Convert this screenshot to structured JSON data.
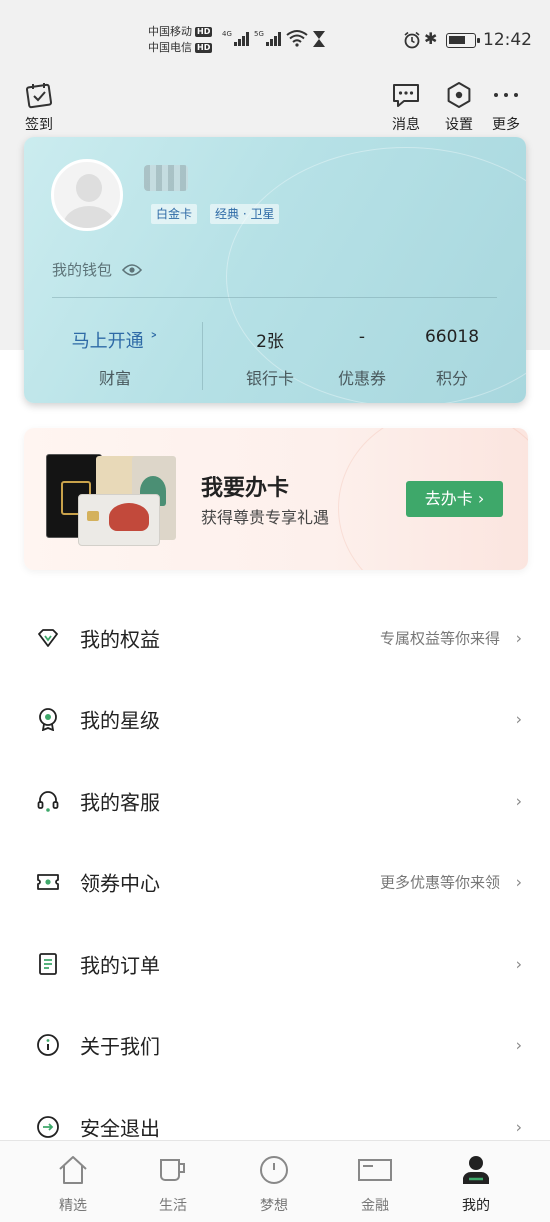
{
  "status_bar": {
    "carrier1": "中国移动",
    "carrier2": "中国电信",
    "hd": "HD",
    "net1": "4G",
    "net2": "5G",
    "time": "12:42"
  },
  "header": {
    "checkin_label": "签到",
    "messages_label": "消息",
    "settings_label": "设置",
    "more_label": "更多"
  },
  "member_card": {
    "tier_tag": "白金卡",
    "card_tag": "经典 · 卫星",
    "wallet_label": "我的钱包",
    "stats": [
      {
        "value": "马上开通 ˃",
        "label": "财富"
      },
      {
        "value": "2张",
        "label": "银行卡"
      },
      {
        "value": "-",
        "label": "优惠券"
      },
      {
        "value": "66018",
        "label": "积分"
      }
    ]
  },
  "promo": {
    "title": "我要办卡",
    "subtitle": "获得尊贵专享礼遇",
    "button": "去办卡 ›"
  },
  "menu": [
    {
      "label": "我的权益",
      "hint": "专属权益等你来得",
      "icon": "diamond-icon"
    },
    {
      "label": "我的星级",
      "hint": "",
      "icon": "star-level-icon"
    },
    {
      "label": "我的客服",
      "hint": "",
      "icon": "headset-icon"
    },
    {
      "label": "领券中心",
      "hint": "更多优惠等你来领",
      "icon": "coupon-icon"
    },
    {
      "label": "我的订单",
      "hint": "",
      "icon": "order-icon"
    },
    {
      "label": "关于我们",
      "hint": "",
      "icon": "info-icon"
    },
    {
      "label": "安全退出",
      "hint": "",
      "icon": "logout-icon"
    }
  ],
  "tabs": [
    {
      "label": "精选",
      "icon": "home-icon"
    },
    {
      "label": "生活",
      "icon": "cup-icon"
    },
    {
      "label": "梦想",
      "icon": "dream-icon"
    },
    {
      "label": "金融",
      "icon": "finance-icon"
    },
    {
      "label": "我的",
      "icon": "person-icon",
      "active": true
    }
  ],
  "colors": {
    "accent_green": "#3ea86a",
    "link_blue": "#2e6aa6",
    "card_bg": "#b6e1e6"
  }
}
